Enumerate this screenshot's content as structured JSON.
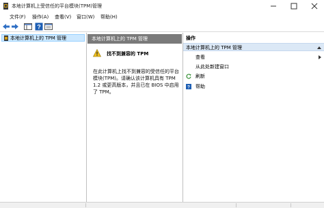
{
  "window": {
    "title": "本地计算机上受信任的平台模块(TPM)管理"
  },
  "menu": {
    "items": [
      "文件(F)",
      "操作(A)",
      "查看(V)",
      "窗口(W)",
      "帮助(H)"
    ]
  },
  "toolbar": {
    "buttons": [
      "back-arrow-icon",
      "forward-arrow-icon",
      "console-tree-icon",
      "help-icon",
      "properties-icon"
    ]
  },
  "tree": {
    "item_label": "本地计算机上的 TPM 管理"
  },
  "center": {
    "header": "本地计算机上的 TPM 管理",
    "error_title": "找不到兼容的 TPM",
    "error_body": "在此计算机上找不到兼容的受信任的平台模块(TPM)。请确认该计算机具有 TPM 1.2 或更高版本，并且已在 BIOS 中启用了 TPM。"
  },
  "actions": {
    "title": "操作",
    "section_label": "本地计算机上的 TPM 管理",
    "items": [
      {
        "label": "查看",
        "icon": "none",
        "has_submenu": true
      },
      {
        "label": "从此处新建窗口",
        "icon": "none",
        "has_submenu": false
      },
      {
        "label": "刷新",
        "icon": "refresh-icon",
        "has_submenu": false
      },
      {
        "label": "帮助",
        "icon": "help-icon",
        "has_submenu": false
      }
    ]
  },
  "colors": {
    "selection_bg": "#cce8ff",
    "center_header_bg": "#7a7a7a",
    "actions_section_bg": "#dbe8f6",
    "help_blue": "#1e5fb4",
    "refresh_green": "#2e8b2e",
    "warning_yellow": "#f0c020"
  }
}
